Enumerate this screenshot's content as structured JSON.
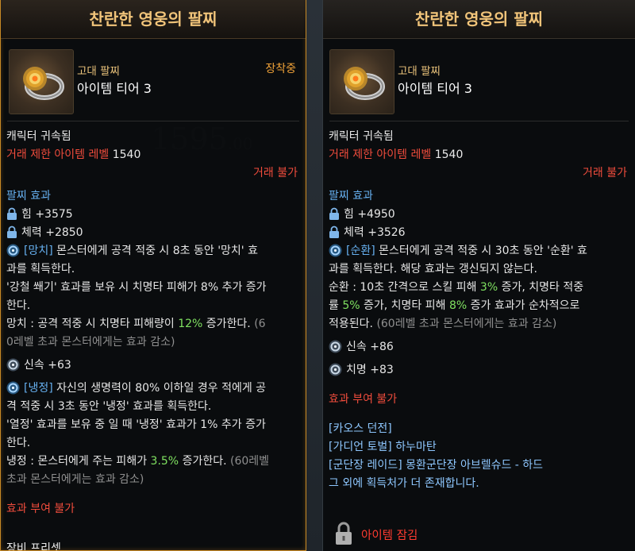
{
  "left_tooltip": {
    "title": "찬란한 영웅의 팔찌",
    "grade": "고대 팔찌",
    "tier": "아이템 티어 3",
    "equipped": "장착중",
    "bound": "캐릭터 귀속됨",
    "trade_limit_label": "거래 제한 아이템 레벨",
    "trade_limit_value": "1540",
    "trade_status": "거래 불가",
    "effects_header": "팔찌 효과",
    "stat_1": "힘 +3575",
    "stat_2": "체력 +2850",
    "effect_a_tag": "[망치]",
    "effect_a_text_1": "몬스터에게 공격 적중 시 8초 동안 '망치' 효",
    "effect_a_text_2": "과를 획득한다.",
    "effect_a_text_3": "'강철 쐐기' 효과를 보유 시 치명타 피해가 8% 추가 증가",
    "effect_a_text_4": "한다.",
    "effect_a_text_5_pre": "망치 : 공격 적중 시 치명타 피해량이",
    "effect_a_text_5_num": "12%",
    "effect_a_text_5_post": "증가한다.",
    "effect_a_text_5_note": "(6",
    "effect_a_text_6": "0레벨 초과 몬스터에게는 효과 감소)",
    "stat_3": "신속 +63",
    "effect_b_tag": "[냉정]",
    "effect_b_text_1": "자신의 생명력이 80% 이하일 경우 적에게 공",
    "effect_b_text_2": "격 적중 시 3초 동안 '냉정' 효과를 획득한다.",
    "effect_b_text_3": "'열정' 효과를 보유 중 일 때 '냉정' 효과가 1% 추가 증가",
    "effect_b_text_4": "한다.",
    "effect_b_text_5_pre": "냉정 : 몬스터에게 주는 피해가",
    "effect_b_text_5_num": "3.5%",
    "effect_b_text_5_post": "증가한다.",
    "effect_b_text_5_note": "(60레벨",
    "effect_b_text_6": "초과 몬스터에게는 효과 감소)",
    "imbue": "효과 부여 불가",
    "set_partial": "장비 프리셋"
  },
  "right_tooltip": {
    "title": "찬란한 영웅의 팔찌",
    "grade": "고대 팔찌",
    "tier": "아이템 티어 3",
    "bound": "캐릭터 귀속됨",
    "trade_limit_label": "거래 제한 아이템 레벨",
    "trade_limit_value": "1540",
    "trade_status": "거래 불가",
    "effects_header": "팔찌 효과",
    "stat_1": "힘 +4950",
    "stat_2": "체력 +3526",
    "effect_tag": "[순환]",
    "effect_text_1": "몬스터에게 공격 적중 시 30초 동안 '순환' 효",
    "effect_text_2": "과를 획득한다. 해당 효과는 갱신되지 않는다.",
    "effect_text_3_pre": "순환 : 10초 간격으로 스킬 피해",
    "effect_text_3_num": "3%",
    "effect_text_3_post": "증가, 치명타 적중",
    "effect_text_4_pre": "률",
    "effect_text_4_num1": "5%",
    "effect_text_4_mid": "증가, 치명타 피해",
    "effect_text_4_num2": "8%",
    "effect_text_4_post": "증가 효과가 순차적으로",
    "effect_text_5": "적용된다.",
    "effect_text_5_note": "(60레벨 초과 몬스터에게는 효과 감소)",
    "stat_3": "신속 +86",
    "stat_4": "치명 +83",
    "imbue": "효과 부여 불가",
    "source_1": "[카오스 던전]",
    "source_2": "[가디언 토벌] 하누마탄",
    "source_3": "[군단장 레이드] 몽환군단장 아브렐슈드 - 하드",
    "source_4": "그 외에 획득처가 더 존재합니다.",
    "lock_label": "아이템 잠김"
  },
  "background": {
    "ghost_number": "1595",
    "ghost_decimal": ".00"
  },
  "colors": {
    "title_gold": "#f1c47a",
    "equipped_orange": "#f0a238",
    "warning_red": "#f04c3c",
    "header_blue": "#66b0f0",
    "value_green": "#7fe060",
    "source_cyan": "#8ec7ff",
    "border_gold": "#c88a25"
  }
}
